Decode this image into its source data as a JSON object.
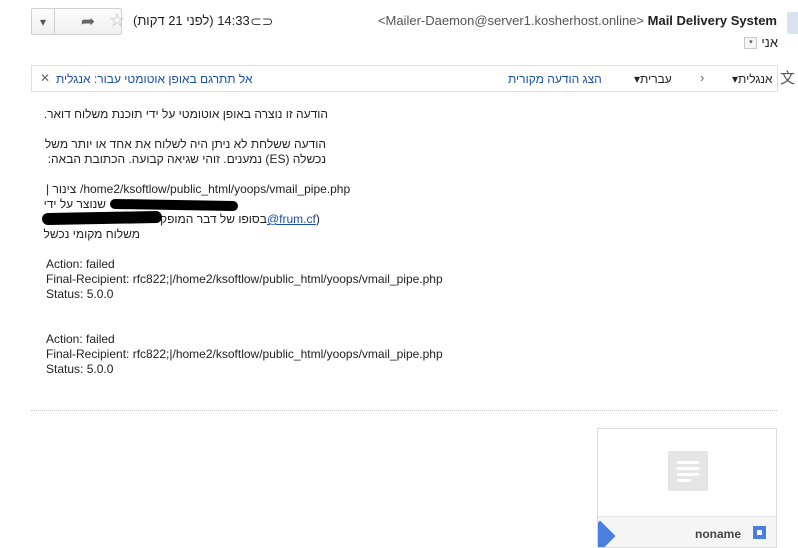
{
  "header": {
    "time": "14:33 (לפני 21 דקות)",
    "sender_name": "Mail Delivery System",
    "sender_email": "<Mailer-Daemon@server1.kosherhost.online>",
    "recipient": "אני"
  },
  "translate_bar": {
    "source_lang": "אנגלית",
    "target_lang": "עברית",
    "show_original": "הצג הודעה מקורית",
    "turn_off": "אל תתרגם באופן אוטומטי עבור: אנגלית"
  },
  "body": {
    "line1": "הודעה זו נוצרה באופן אוטומטי על ידי תוכנת משלוח דואר.",
    "line2": "הודעה ששלחת לא ניתן היה לשלוח את אחד או יותר משל",
    "line3": "נכשלה (ES) נמענים. זוהי שגיאה קבועה. הכתובת הבאה:",
    "line4_path": "/home2/ksoftlow/public_html/yoops/vmail_pipe.php",
    "line4_prefix": "צינור |",
    "line5": "שנוצר על ידי",
    "line6_rtl": "בסופו של דבר המופק",
    "line6_link": "@frum.cf",
    "line7": "משלוח מקומי נכשל",
    "block1": {
      "action": "Action: failed",
      "recipient": "Final-Recipient: rfc822;|/home2/ksoftlow/public_html/yoops/vmail_pipe.php",
      "status": "Status: 5.0.0"
    },
    "block2": {
      "action": "Action: failed",
      "recipient": "Final-Recipient: rfc822;|/home2/ksoftlow/public_html/yoops/vmail_pipe.php",
      "status": "Status: 5.0.0"
    }
  },
  "attachment": {
    "filename": "noname"
  },
  "colors": {
    "link": "#1a4fa8",
    "attachment_accent": "#4a7ee0"
  }
}
